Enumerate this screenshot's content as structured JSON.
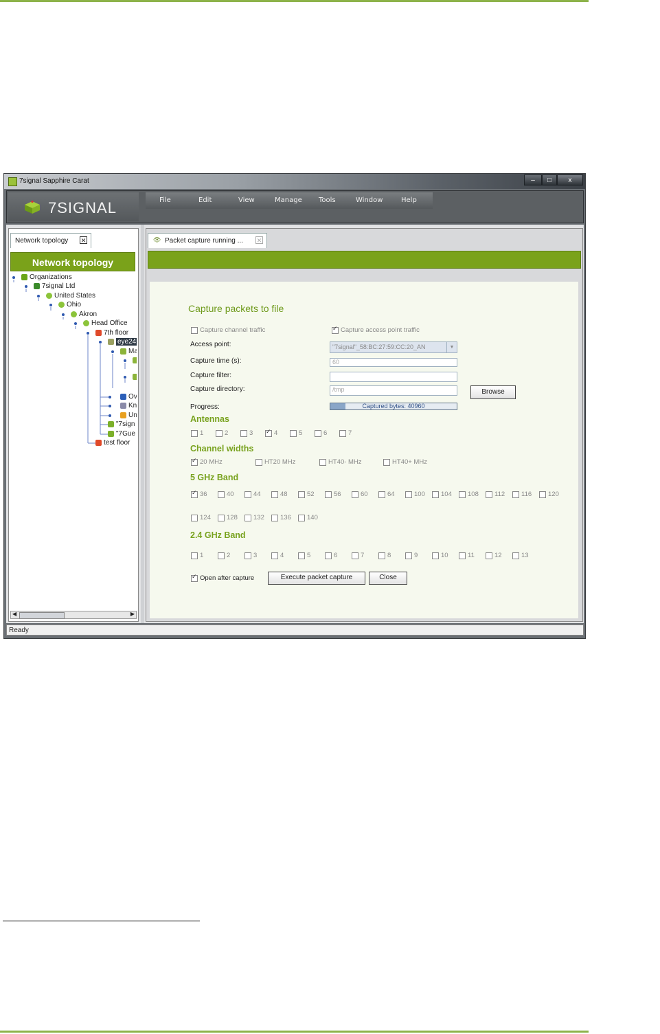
{
  "window": {
    "title": "7signal Sapphire Carat",
    "min": "–",
    "max": "□",
    "close": "x"
  },
  "logo": {
    "text": "7SIGNAL"
  },
  "menu": [
    "File",
    "Edit",
    "View",
    "Manage",
    "Tools",
    "Window",
    "Help"
  ],
  "left_tab": {
    "label": "Network topology"
  },
  "nav_header": "Network topology",
  "tree": [
    {
      "label": "Organizations",
      "icon": "org-icon",
      "color": "#6aa516"
    },
    {
      "label": "7signal Ltd",
      "icon": "company-icon",
      "color": "#3a8a2a"
    },
    {
      "label": "United States",
      "icon": "globe-icon",
      "color": "#8cc43a"
    },
    {
      "label": "Ohio",
      "icon": "globe-icon",
      "color": "#8cc43a"
    },
    {
      "label": "Akron",
      "icon": "globe-icon",
      "color": "#8cc43a"
    },
    {
      "label": "Head Office",
      "icon": "globe-icon",
      "color": "#8cc43a"
    },
    {
      "label": "7th floor",
      "icon": "floor-icon",
      "color": "#e04a2a"
    },
    {
      "label": "eye24",
      "icon": "sensor-icon",
      "color": "#9aa060"
    },
    {
      "label": "Ma",
      "icon": "radio-icon",
      "color": "#8cb43a"
    },
    {
      "label": "Ov",
      "icon": "ap-icon",
      "color": "#2c5fb8"
    },
    {
      "label": "Kn",
      "icon": "ap-icon",
      "color": "#8a8aa8"
    },
    {
      "label": "Un",
      "icon": "unknown-icon",
      "color": "#e8a020"
    },
    {
      "label": "\"7sign",
      "icon": "ssid-icon",
      "color": "#7cb02a"
    },
    {
      "label": "\"7Gue",
      "icon": "ssid-icon",
      "color": "#7cb02a"
    },
    {
      "label": "test floor",
      "icon": "floor-icon",
      "color": "#e04a2a"
    }
  ],
  "right_tab": {
    "label": "Packet capture running ..."
  },
  "form": {
    "title": "Capture packets to file",
    "capture_channel_traffic": "Capture channel traffic",
    "capture_ap_traffic": "Capture access point traffic",
    "access_point_label": "Access point:",
    "access_point_value": "\"7signal\"_58:BC:27:59:CC:20_AN",
    "capture_time_label": "Capture time (s):",
    "capture_time_value": "60",
    "capture_filter_label": "Capture filter:",
    "capture_filter_value": "",
    "capture_directory_label": "Capture directory:",
    "capture_directory_value": "/tmp",
    "browse": "Browse",
    "progress_label": "Progress:",
    "progress_text": "Captured bytes: 40960",
    "progress_fraction": 0.12,
    "antennas_title": "Antennas",
    "antennas": [
      {
        "label": "1",
        "checked": false
      },
      {
        "label": "2",
        "checked": false
      },
      {
        "label": "3",
        "checked": false
      },
      {
        "label": "4",
        "checked": true
      },
      {
        "label": "5",
        "checked": false
      },
      {
        "label": "6",
        "checked": false
      },
      {
        "label": "7",
        "checked": false
      }
    ],
    "channel_widths_title": "Channel widths",
    "channel_widths": [
      {
        "label": "20 MHz",
        "checked": true
      },
      {
        "label": "HT20 MHz",
        "checked": false
      },
      {
        "label": "HT40- MHz",
        "checked": false
      },
      {
        "label": "HT40+ MHz",
        "checked": false
      }
    ],
    "band5_title": "5 GHz Band",
    "band5_row1": [
      {
        "label": "36",
        "checked": true
      },
      {
        "label": "40"
      },
      {
        "label": "44"
      },
      {
        "label": "48"
      },
      {
        "label": "52"
      },
      {
        "label": "56"
      },
      {
        "label": "60"
      },
      {
        "label": "64"
      },
      {
        "label": "100"
      },
      {
        "label": "104"
      },
      {
        "label": "108"
      },
      {
        "label": "112"
      },
      {
        "label": "116"
      },
      {
        "label": "120"
      }
    ],
    "band5_row2": [
      {
        "label": "124"
      },
      {
        "label": "128"
      },
      {
        "label": "132"
      },
      {
        "label": "136"
      },
      {
        "label": "140"
      }
    ],
    "band24_title": "2.4 GHz Band",
    "band24": [
      {
        "label": "1"
      },
      {
        "label": "2"
      },
      {
        "label": "3"
      },
      {
        "label": "4"
      },
      {
        "label": "5"
      },
      {
        "label": "6"
      },
      {
        "label": "7"
      },
      {
        "label": "8"
      },
      {
        "label": "9"
      },
      {
        "label": "10"
      },
      {
        "label": "11"
      },
      {
        "label": "12"
      },
      {
        "label": "13"
      }
    ],
    "open_after_capture": "Open after capture",
    "execute": "Execute packet capture",
    "close": "Close"
  },
  "status": "Ready",
  "colors": {
    "accent_green": "#7aa21a",
    "title_green": "#6e9a1b",
    "doc_rule": "#8db34a"
  }
}
